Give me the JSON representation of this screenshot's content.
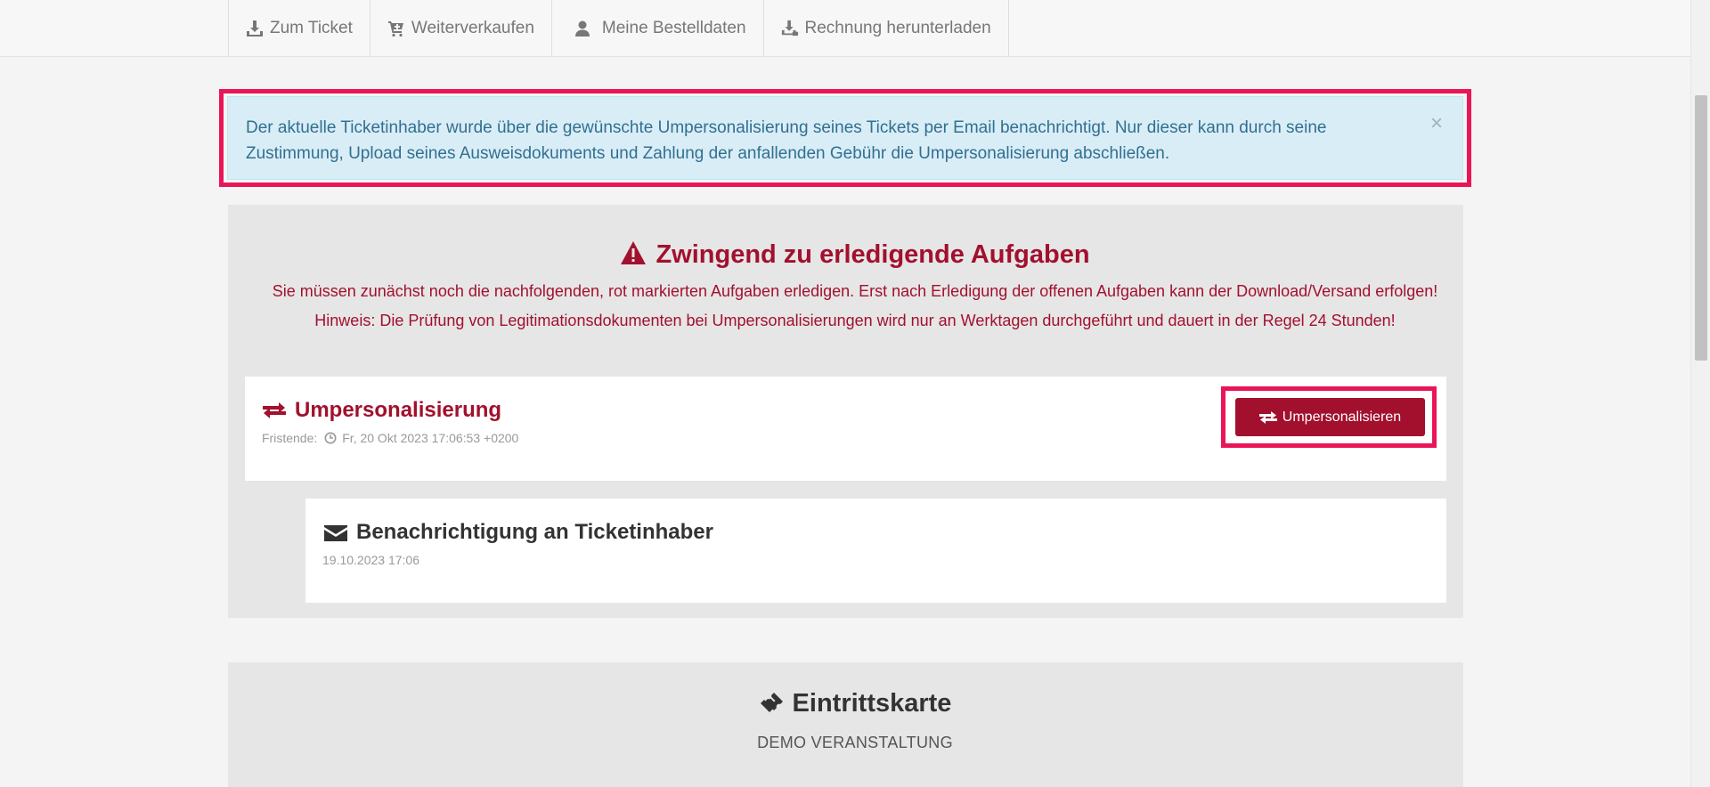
{
  "nav": {
    "items": [
      {
        "label": "Zum Ticket",
        "icon": "download-icon"
      },
      {
        "label": "Weiterverkaufen",
        "icon": "cart-icon"
      },
      {
        "label": "Meine Bestelldaten",
        "icon": "user-icon"
      },
      {
        "label": "Rechnung herunterladen",
        "icon": "invoice-download-icon"
      }
    ]
  },
  "alert": {
    "text": "Der aktuelle Ticketinhaber wurde über die gewünschte Umpersonalisierung seines Tickets per Email benachrichtigt. Nur dieser kann durch seine Zustimmung, Upload seines Ausweisdokuments und Zahlung der anfallenden Gebühr die Umpersonalisierung abschließen.",
    "close": "×"
  },
  "tasks": {
    "title": "Zwingend zu erledigende Aufgaben",
    "line1": "Sie müssen zunächst noch die nachfolgenden, rot markierten Aufgaben erledigen. Erst nach Erledigung der offenen Aufgaben kann der Download/Versand erfolgen!",
    "line2": "Hinweis: Die Prüfung von Legitimationsdokumenten bei Umpersonalisierungen wird nur an Werktagen durchgeführt und dauert in der Regel 24 Stunden!",
    "card1": {
      "title": "Umpersonalisierung",
      "deadline_label": "Fristende:",
      "deadline_value": "Fr, 20 Okt 2023 17:06:53 +0200",
      "button": "Umpersonalisieren"
    },
    "card2": {
      "title": "Benachrichtigung an Ticketinhaber",
      "date": "19.10.2023 17:06"
    }
  },
  "ticket": {
    "title": "Eintrittskarte",
    "event": "DEMO VERANSTALTUNG"
  },
  "colors": {
    "accent": "#a2102e",
    "highlight": "#ea1558",
    "alert_bg": "#d9edf7",
    "alert_text": "#31708f"
  }
}
